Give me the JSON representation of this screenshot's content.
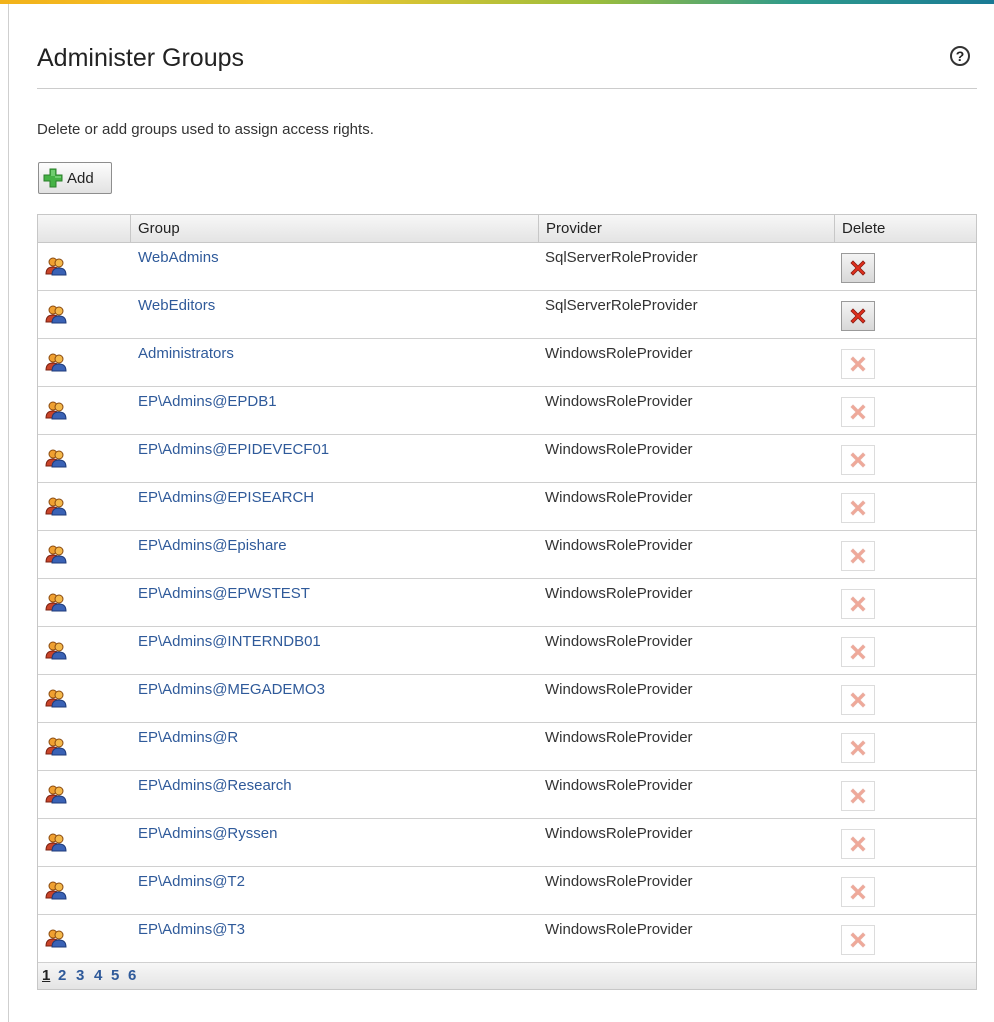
{
  "header": {
    "title": "Administer Groups",
    "help_label": "?"
  },
  "description": "Delete or add groups used to assign access rights.",
  "toolbar": {
    "add_label": "Add"
  },
  "table": {
    "columns": [
      "Group",
      "Provider",
      "Delete"
    ],
    "rows": [
      {
        "group": "WebAdmins",
        "provider": "SqlServerRoleProvider",
        "deletable": true
      },
      {
        "group": "WebEditors",
        "provider": "SqlServerRoleProvider",
        "deletable": true
      },
      {
        "group": "Administrators",
        "provider": "WindowsRoleProvider",
        "deletable": false
      },
      {
        "group": "EP\\Admins@EPDB1",
        "provider": "WindowsRoleProvider",
        "deletable": false
      },
      {
        "group": "EP\\Admins@EPIDEVECF01",
        "provider": "WindowsRoleProvider",
        "deletable": false
      },
      {
        "group": "EP\\Admins@EPISEARCH",
        "provider": "WindowsRoleProvider",
        "deletable": false
      },
      {
        "group": "EP\\Admins@Epishare",
        "provider": "WindowsRoleProvider",
        "deletable": false
      },
      {
        "group": "EP\\Admins@EPWSTEST",
        "provider": "WindowsRoleProvider",
        "deletable": false
      },
      {
        "group": "EP\\Admins@INTERNDB01",
        "provider": "WindowsRoleProvider",
        "deletable": false
      },
      {
        "group": "EP\\Admins@MEGADEMO3",
        "provider": "WindowsRoleProvider",
        "deletable": false
      },
      {
        "group": "EP\\Admins@R",
        "provider": "WindowsRoleProvider",
        "deletable": false
      },
      {
        "group": "EP\\Admins@Research",
        "provider": "WindowsRoleProvider",
        "deletable": false
      },
      {
        "group": "EP\\Admins@Ryssen",
        "provider": "WindowsRoleProvider",
        "deletable": false
      },
      {
        "group": "EP\\Admins@T2",
        "provider": "WindowsRoleProvider",
        "deletable": false
      },
      {
        "group": "EP\\Admins@T3",
        "provider": "WindowsRoleProvider",
        "deletable": false
      }
    ]
  },
  "pager": {
    "pages": [
      "1",
      "2",
      "3",
      "4",
      "5",
      "6"
    ],
    "current": "1"
  },
  "icons": {
    "group": "group-users-icon",
    "delete": "delete-x-icon",
    "add": "add-plus-icon",
    "help": "help-icon"
  },
  "colors": {
    "link": "#2f5a9a",
    "delete_active": "#e0301e",
    "delete_inactive": "#f0a898",
    "add_plus": "#3aa83a"
  }
}
